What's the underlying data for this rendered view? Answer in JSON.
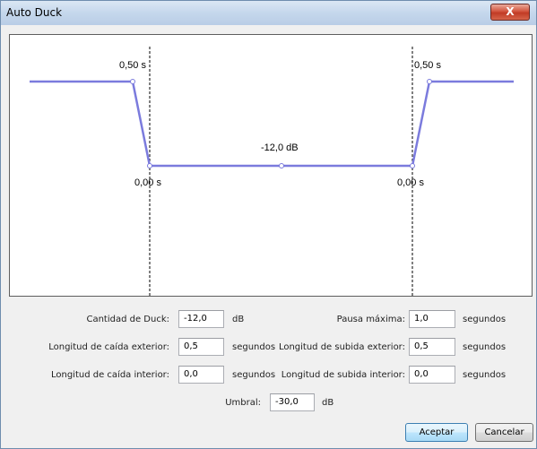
{
  "window": {
    "title": "Auto Duck",
    "close_label": "X"
  },
  "graph": {
    "label_fade_out_outer": "0,50 s",
    "label_fade_in_outer": "0,50 s",
    "label_fade_out_inner": "0,00 s",
    "label_fade_in_inner": "0,00 s",
    "label_duck_amount": "-12,0 dB",
    "line_color": "#7b7bdd"
  },
  "form": {
    "duck_amount": {
      "label": "Cantidad de Duck:",
      "value": "-12,0",
      "unit": "dB"
    },
    "max_pause": {
      "label": "Pausa máxima:",
      "value": "1,0",
      "unit": "segundos"
    },
    "outer_fade_down": {
      "label": "Longitud de caída exterior:",
      "value": "0,5",
      "unit": "segundos"
    },
    "outer_fade_up": {
      "label": "Longitud de subida exterior:",
      "value": "0,5",
      "unit": "segundos"
    },
    "inner_fade_down": {
      "label": "Longitud de caída interior:",
      "value": "0,0",
      "unit": "segundos"
    },
    "inner_fade_up": {
      "label": "Longitud de subida interior:",
      "value": "0,0",
      "unit": "segundos"
    },
    "threshold": {
      "label": "Umbral:",
      "value": "-30,0",
      "unit": "dB"
    }
  },
  "buttons": {
    "ok": "Aceptar",
    "cancel": "Cancelar"
  }
}
